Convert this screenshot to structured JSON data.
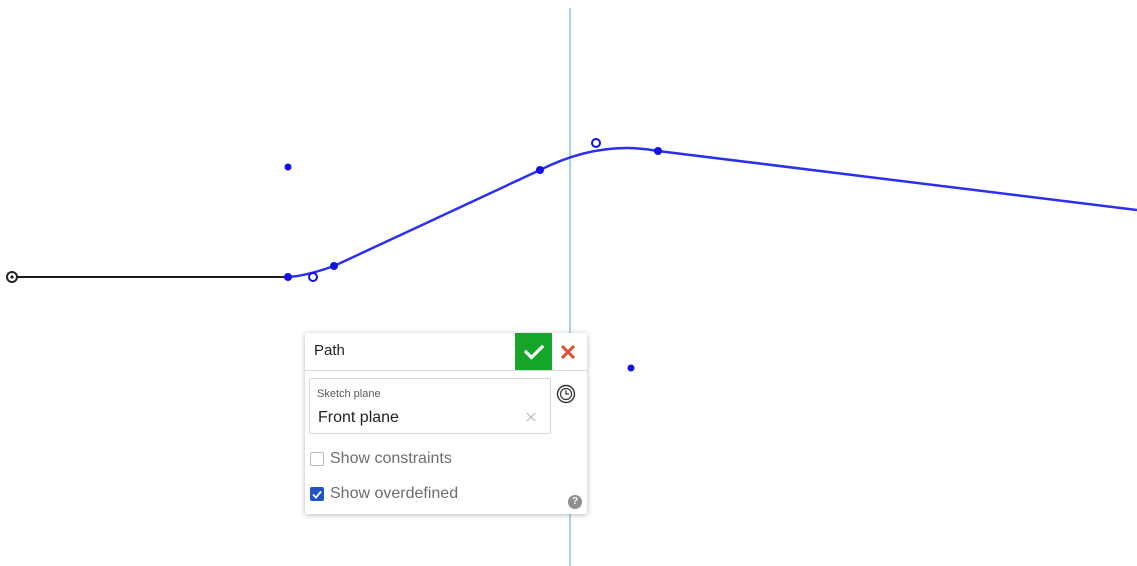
{
  "dialog": {
    "title": "Path",
    "sketch_plane_label": "Sketch plane",
    "sketch_plane_value": "Front plane",
    "show_constraints_label": "Show constraints",
    "show_constraints_checked": false,
    "show_overdefined_label": "Show overdefined",
    "show_overdefined_checked": true,
    "help_glyph": "?"
  },
  "icons": {
    "accept": "checkmark-icon",
    "cancel": "close-icon",
    "clear": "clear-x-icon",
    "history": "clock-icon",
    "help": "help-icon"
  },
  "colors": {
    "path_curve": "#2b2ff0",
    "sketch_line": "#1e1e1e",
    "plane_axis": "#a9d2ef",
    "accept_green": "#15a629",
    "cancel_red": "#e0502a",
    "checkbox_blue": "#1f53c6"
  }
}
